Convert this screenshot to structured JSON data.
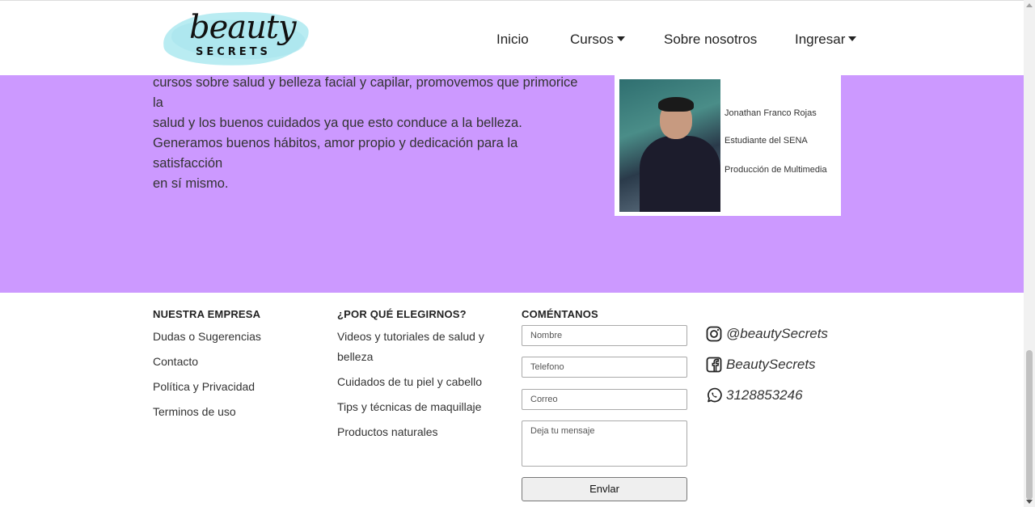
{
  "logo": {
    "word": "beauty",
    "sub": "SECRETS"
  },
  "nav": {
    "inicio": "Inicio",
    "cursos": "Cursos",
    "sobre": "Sobre nosotros",
    "ingresar": "Ingresar"
  },
  "about": {
    "lines": [
      "cursos sobre salud y belleza facial y capilar, promovemos que primorice la",
      "salud y los buenos cuidados ya que esto conduce a la belleza.",
      "Generamos buenos hábitos, amor propio y dedicación para la satisfacción",
      "en sí mismo."
    ]
  },
  "card": {
    "name": "Jonathan Franco Rojas",
    "role": "Estudiante del SENA",
    "program": "Producción de Multimedia"
  },
  "footer": {
    "empresa": {
      "title": "NUESTRA EMPRESA",
      "links": [
        "Dudas o Sugerencias",
        "Contacto",
        "Política y Privacidad",
        "Terminos de uso"
      ]
    },
    "porque": {
      "title": "¿POR QUÉ ELEGIRNOS?",
      "links": [
        "Videos y tutoriales de salud y",
        "belleza",
        "Cuidados de tu piel y cabello",
        "Tips y técnicas de maquillaje",
        "Productos naturales"
      ]
    },
    "comentanos": {
      "title": "COMÉNTANOS",
      "nombre": "Nombre",
      "telefono": "Telefono",
      "correo": "Correo",
      "mensaje": "Deja tu mensaje",
      "enviar": "Envlar"
    },
    "social": {
      "instagram": "@beautySecrets",
      "facebook": "BeautySecrets",
      "whatsapp": "3128853246"
    }
  },
  "colors": {
    "purple": "#cc99ff",
    "logo_splash": "#b9ecf2"
  }
}
